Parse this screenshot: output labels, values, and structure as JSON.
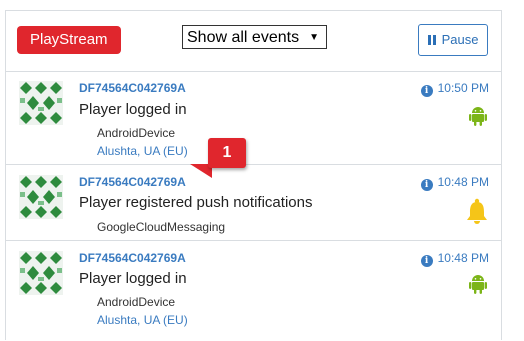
{
  "header": {
    "badge": "PlayStream",
    "filter": "Show all events",
    "pause": "Pause"
  },
  "callout": "1",
  "events": [
    {
      "player_id": "DF74564C042769A",
      "text": "Player logged in",
      "device": "AndroidDevice",
      "location": "Alushta, UA (EU)",
      "time": "10:50 PM",
      "platform_icon": "android-icon"
    },
    {
      "player_id": "DF74564C042769A",
      "text": "Player registered push notifications",
      "device": "GoogleCloudMessaging",
      "location": "",
      "time": "10:48 PM",
      "platform_icon": "bell-icon"
    },
    {
      "player_id": "DF74564C042769A",
      "text": "Player logged in",
      "device": "AndroidDevice",
      "location": "Alushta, UA (EU)",
      "time": "10:48 PM",
      "platform_icon": "android-icon"
    }
  ],
  "colors": {
    "brand_red": "#e0262d",
    "link_blue": "#3a7bc0",
    "avatar_green": "#2e8b3e",
    "android_green": "#7cb518",
    "bell_yellow": "#f5c518"
  }
}
